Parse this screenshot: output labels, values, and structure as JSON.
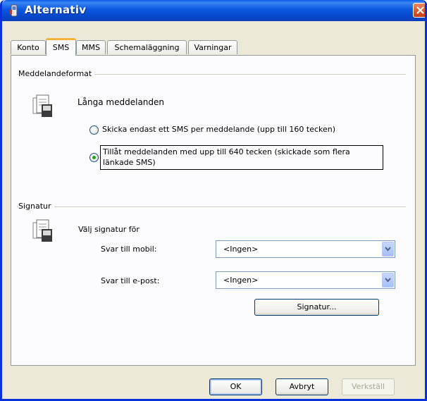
{
  "window": {
    "title": "Alternativ"
  },
  "tabs": [
    {
      "label": "Konto"
    },
    {
      "label": "SMS"
    },
    {
      "label": "MMS"
    },
    {
      "label": "Schemaläggning"
    },
    {
      "label": "Varningar"
    }
  ],
  "message_format": {
    "group_label": "Meddelandeformat",
    "heading": "Långa meddelanden",
    "option_single": "Skicka endast ett SMS per meddelande (upp till 160 tecken)",
    "option_long_line1": "Tillåt meddelanden med upp till 640 tecken (skickade som flera",
    "option_long_line2": "länkade SMS)",
    "selected": "option_long"
  },
  "signature": {
    "group_label": "Signatur",
    "heading": "Välj signatur för",
    "mobile_label": "Svar till mobil:",
    "mobile_value": "<Ingen>",
    "email_label": "Svar till e-post:",
    "email_value": "<Ingen>",
    "signature_button": "Signatur..."
  },
  "buttons": {
    "ok": "OK",
    "cancel": "Avbryt",
    "apply": "Verkställ"
  }
}
